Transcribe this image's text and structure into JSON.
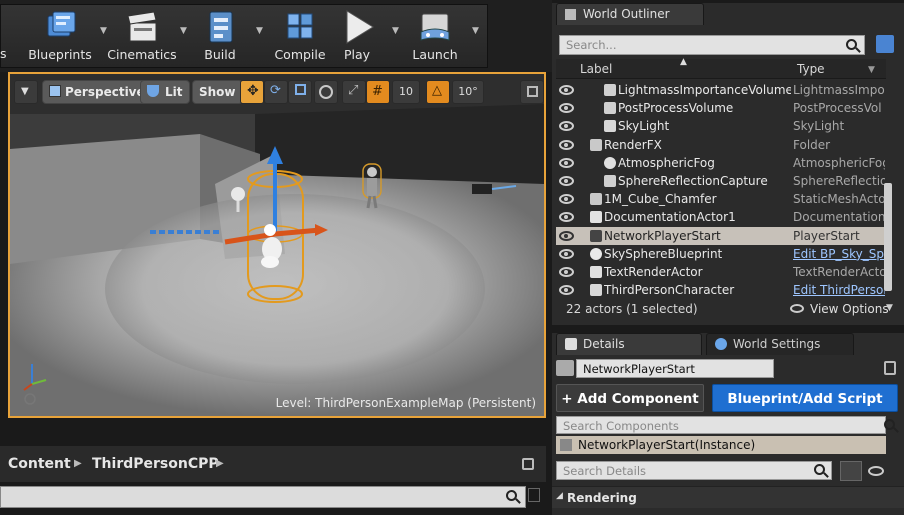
{
  "toolbar": {
    "left_partial_label": "s",
    "buttons": [
      {
        "label": "Blueprints",
        "icon": "blueprints-icon"
      },
      {
        "label": "Cinematics",
        "icon": "cinematics-clapper-icon"
      },
      {
        "label": "Build",
        "icon": "build-icon"
      },
      {
        "label": "Compile",
        "icon": "compile-cubes-icon"
      },
      {
        "label": "Play",
        "icon": "play-icon"
      },
      {
        "label": "Launch",
        "icon": "launch-gamepad-icon"
      }
    ]
  },
  "viewport": {
    "view_mode": "Perspective",
    "lighting": "Lit",
    "show": "Show",
    "grid_snap": "10",
    "rotation_snap": "10°",
    "level_label": "Level:  ThirdPersonExampleMap (Persistent)",
    "accent_color": "#e8a33a"
  },
  "content_browser": {
    "breadcrumb": [
      "Content",
      "ThirdPersonCPP"
    ],
    "separator": "▶"
  },
  "outliner": {
    "tab_title": "World Outliner",
    "search_placeholder": "Search...",
    "col_label": "Label",
    "col_type": "Type",
    "rows": [
      {
        "name": "LightmassImportanceVolume",
        "type": "LightmassImpor",
        "indent": 2,
        "icon": "volume-icon",
        "link": false,
        "selected": false
      },
      {
        "name": "PostProcessVolume",
        "type": "PostProcessVol",
        "indent": 2,
        "icon": "volume-icon",
        "link": false,
        "selected": false
      },
      {
        "name": "SkyLight",
        "type": "SkyLight",
        "indent": 2,
        "icon": "skylight-icon",
        "link": false,
        "selected": false
      },
      {
        "name": "RenderFX",
        "type": "Folder",
        "indent": 1,
        "icon": "folder-icon",
        "link": false,
        "selected": false,
        "expander": true
      },
      {
        "name": "AtmosphericFog",
        "type": "AtmosphericFog",
        "indent": 2,
        "icon": "fog-icon",
        "link": false,
        "selected": false
      },
      {
        "name": "SphereReflectionCapture",
        "type": "SphereReflection",
        "indent": 2,
        "icon": "reflection-capture-icon",
        "link": false,
        "selected": false
      },
      {
        "name": "1M_Cube_Chamfer",
        "type": "StaticMeshActor",
        "indent": 1,
        "icon": "static-mesh-icon",
        "link": false,
        "selected": false
      },
      {
        "name": "DocumentationActor1",
        "type": "DocumentationA",
        "indent": 1,
        "icon": "documentation-icon",
        "link": false,
        "selected": false
      },
      {
        "name": "NetworkPlayerStart",
        "type": "PlayerStart",
        "indent": 1,
        "icon": "player-start-icon",
        "link": false,
        "selected": true
      },
      {
        "name": "SkySphereBlueprint",
        "type": "Edit BP_Sky_Sp",
        "indent": 1,
        "icon": "sphere-icon",
        "link": true,
        "selected": false
      },
      {
        "name": "TextRenderActor",
        "type": "TextRenderActo",
        "indent": 1,
        "icon": "text-render-icon",
        "link": false,
        "selected": false
      },
      {
        "name": "ThirdPersonCharacter",
        "type": "Edit ThirdPerson",
        "indent": 1,
        "icon": "character-icon",
        "link": true,
        "selected": false
      }
    ],
    "actor_count": "22 actors (1 selected)",
    "view_options": "View Options"
  },
  "details": {
    "tab_details": "Details",
    "tab_world_settings": "World Settings",
    "name_value": "NetworkPlayerStart",
    "add_component": "+ Add Component",
    "blueprint_script": "Blueprint/Add Script",
    "search_components_placeholder": "Search Components",
    "instance_row": "NetworkPlayerStart(Instance)",
    "search_details_placeholder": "Search Details",
    "rendering_section": "Rendering",
    "add_component_color": "#3b3b3b",
    "blueprint_color": "#1f6fd1"
  }
}
